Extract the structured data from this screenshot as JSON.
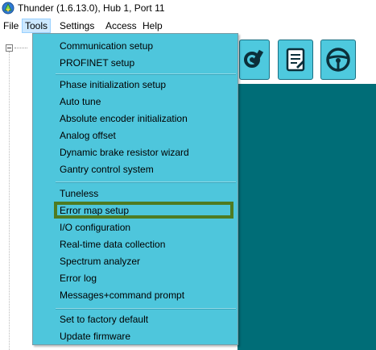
{
  "window": {
    "title": "Thunder (1.6.13.0), Hub 1, Port 11",
    "app_icon": "thunder-app-icon"
  },
  "menubar": {
    "items": [
      {
        "label": "File"
      },
      {
        "label": "Tools",
        "active": true
      },
      {
        "label": "Settings"
      },
      {
        "label": "Access"
      },
      {
        "label": "Help"
      }
    ]
  },
  "tools_menu": {
    "groups": [
      [
        "Communication setup",
        "PROFINET setup"
      ],
      [
        "Phase initialization setup",
        "Auto tune",
        "Absolute encoder initialization",
        "Analog offset",
        "Dynamic brake resistor wizard",
        "Gantry control system"
      ],
      [
        "Tuneless",
        "Error map setup",
        "I/O configuration",
        "Real-time data collection",
        "Spectrum analyzer",
        "Error log",
        "Messages+command prompt"
      ],
      [
        "Set to factory default",
        "Update firmware"
      ]
    ],
    "highlighted_item": "Error map setup"
  },
  "toolbar": {
    "buttons": [
      {
        "icon": "gear-wrench-icon"
      },
      {
        "icon": "document-edit-icon"
      },
      {
        "icon": "steering-wheel-icon"
      }
    ]
  },
  "colors": {
    "menu_bg": "#4ec6dc",
    "main_bg": "#006d77",
    "highlight_border": "#4f7b22",
    "button_bg": "#4ec9de"
  }
}
